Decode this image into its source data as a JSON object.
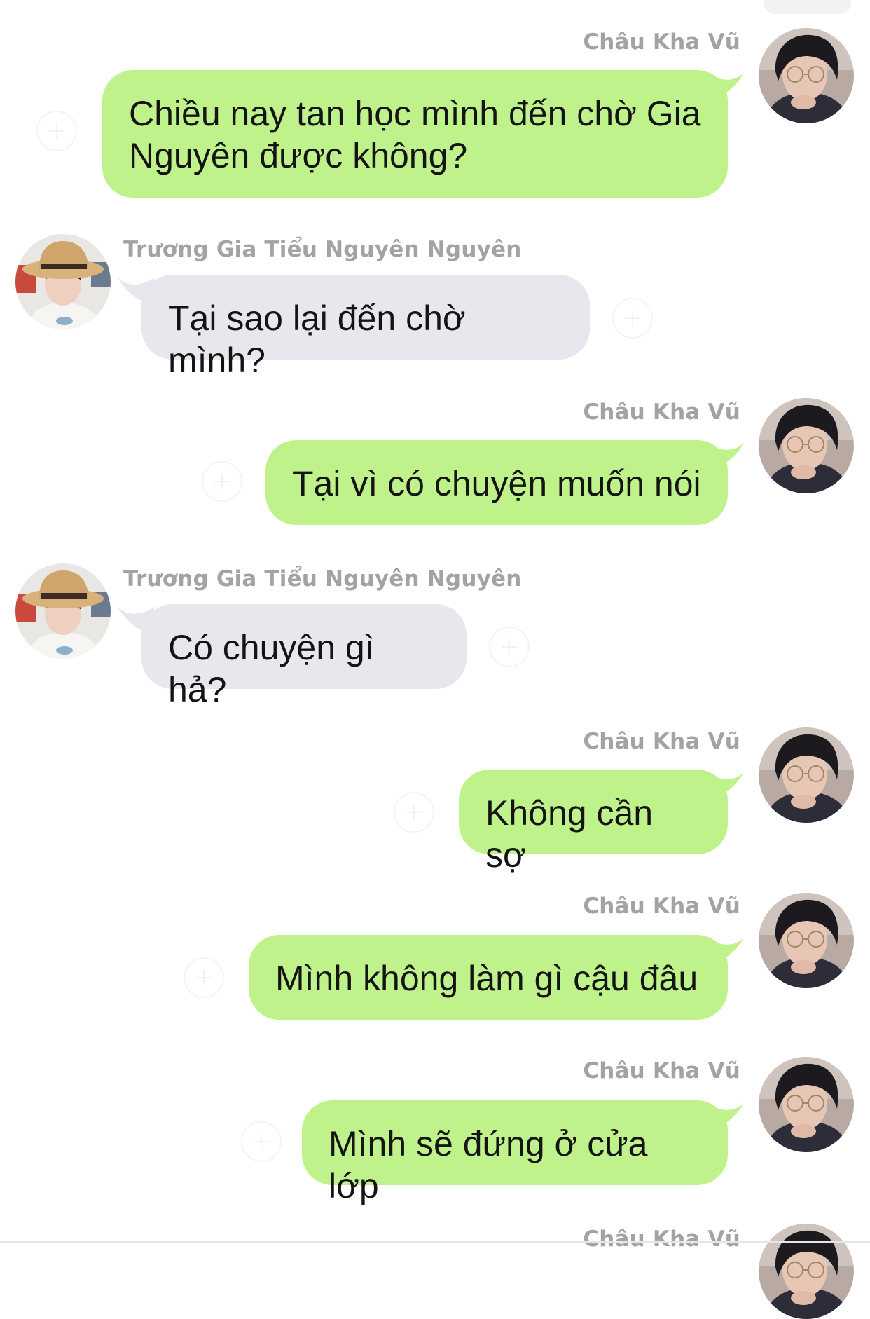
{
  "colors": {
    "sent_bubble": "#c0f28c",
    "received_bubble": "#e7e8ed",
    "name_text": "#a3a3a7"
  },
  "messages": [
    {
      "sender": "Châu Kha Vũ",
      "side": "right",
      "text_lines": [
        "Chiều nay tan học mình đến chờ Gia",
        "Nguyên được không?"
      ]
    },
    {
      "sender": "Trương Gia Tiểu Nguyên Nguyên",
      "side": "left",
      "text_lines": [
        "Tại sao lại đến chờ mình?"
      ]
    },
    {
      "sender": "Châu Kha Vũ",
      "side": "right",
      "text_lines": [
        "Tại vì có chuyện muốn nói"
      ]
    },
    {
      "sender": "Trương Gia Tiểu Nguyên Nguyên",
      "side": "left",
      "text_lines": [
        "Có chuyện gì hả?"
      ]
    },
    {
      "sender": "Châu Kha Vũ",
      "side": "right",
      "text_lines": [
        "Không cần sợ"
      ]
    },
    {
      "sender": "Châu Kha Vũ",
      "side": "right",
      "text_lines": [
        "Mình không làm gì cậu đâu"
      ]
    },
    {
      "sender": "Châu Kha Vũ",
      "side": "right",
      "text_lines": [
        "Mình sẽ đứng ở cửa lớp"
      ]
    },
    {
      "sender": "Châu Kha Vũ",
      "side": "right",
      "text_lines": []
    }
  ],
  "icons": {
    "reaction": "add-reaction-icon",
    "avatar_right": "avatar-glasses-boy",
    "avatar_left": "avatar-straw-hat-boy"
  }
}
